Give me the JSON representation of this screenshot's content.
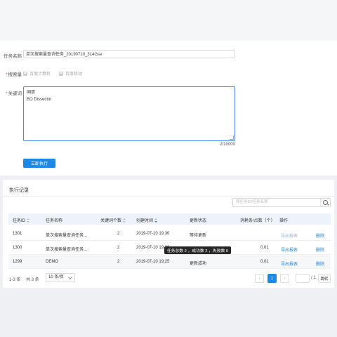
{
  "form": {
    "task_name_label": "任务名称",
    "task_name_value": "单次搜索量查询任务_20190710_314Gse",
    "engine_label": "搜索量",
    "engine_options": [
      "百度计算机",
      "百度移动"
    ],
    "keywords_label": "关键词",
    "keywords_lines": [
      "国双",
      "EO Dissector"
    ],
    "counter": "2/10000",
    "submit_label": "立即执行"
  },
  "records": {
    "title": "执行记录",
    "search_placeholder": "按任务ID/任务名称",
    "columns": [
      "任务ID",
      "任务名称",
      "关键词个数",
      "创建时间",
      "更新状态",
      "消耗条/点数（个）",
      "操作"
    ],
    "rows": [
      {
        "id": "1301",
        "name": "单次搜索量查询任务...",
        "count": "2",
        "created": "2019-07-10 19:30",
        "status": "等待更新",
        "cost": "",
        "export": "导出报表",
        "delete": "删除",
        "export_disabled": true
      },
      {
        "id": "1300",
        "name": "单次搜索量查询任务...",
        "count": "2",
        "created": "2019-07-10 19:30",
        "status": "",
        "cost": "0.01",
        "export": "导出报表",
        "delete": "删除",
        "export_disabled": false
      },
      {
        "id": "1299",
        "name": "DEMO",
        "count": "2",
        "created": "2019-07-10 19:25",
        "status": "更新成功",
        "cost": "0.01",
        "export": "导出报表",
        "delete": "删除",
        "export_disabled": false
      }
    ],
    "tooltip": "任务总数 2 ，成功数 2 ，失败数 0"
  },
  "pagination": {
    "range": "1-3 条",
    "total": "共 3 条",
    "page_size": "10 条/页",
    "current": "1",
    "prev": "‹",
    "next": "›",
    "of_total": "/ 1",
    "go_label": "跳转"
  },
  "colors": {
    "accent": "#1e88e5",
    "required": "#f04134",
    "tooltip_bg": "#262626"
  }
}
